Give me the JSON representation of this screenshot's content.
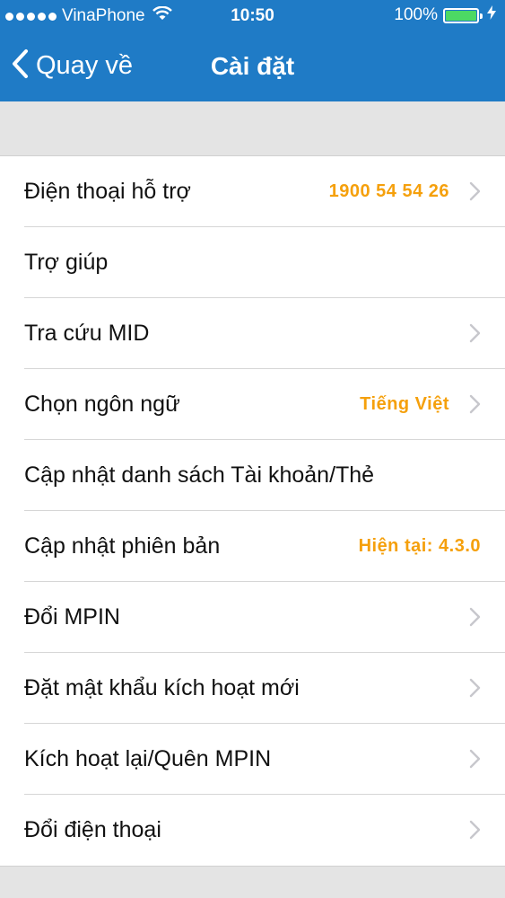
{
  "status_bar": {
    "carrier": "VinaPhone",
    "time": "10:50",
    "battery": "100%",
    "battery_level": 1.0,
    "signal_bars": 5
  },
  "nav": {
    "back_label": "Quay về",
    "title": "Cài đặt"
  },
  "colors": {
    "header": "#1f7bc6",
    "accent": "#f5a00c",
    "battery": "#4cd964"
  },
  "settings": {
    "items": [
      {
        "label": "Điện thoại hỗ trợ",
        "value": "1900 54 54 26",
        "chevron": true
      },
      {
        "label": "Trợ giúp",
        "value": "",
        "chevron": false
      },
      {
        "label": "Tra cứu MID",
        "value": "",
        "chevron": true
      },
      {
        "label": "Chọn ngôn ngữ",
        "value": "Tiếng Việt",
        "chevron": true
      },
      {
        "label": "Cập nhật danh sách Tài khoản/Thẻ",
        "value": "",
        "chevron": false
      },
      {
        "label": "Cập nhật phiên bản",
        "value": "Hiện tại: 4.3.0",
        "chevron": false
      },
      {
        "label": "Đổi MPIN",
        "value": "",
        "chevron": true
      },
      {
        "label": "Đặt mật khẩu kích hoạt mới",
        "value": "",
        "chevron": true
      },
      {
        "label": "Kích hoạt lại/Quên MPIN",
        "value": "",
        "chevron": true
      },
      {
        "label": "Đổi điện thoại",
        "value": "",
        "chevron": true
      }
    ]
  }
}
